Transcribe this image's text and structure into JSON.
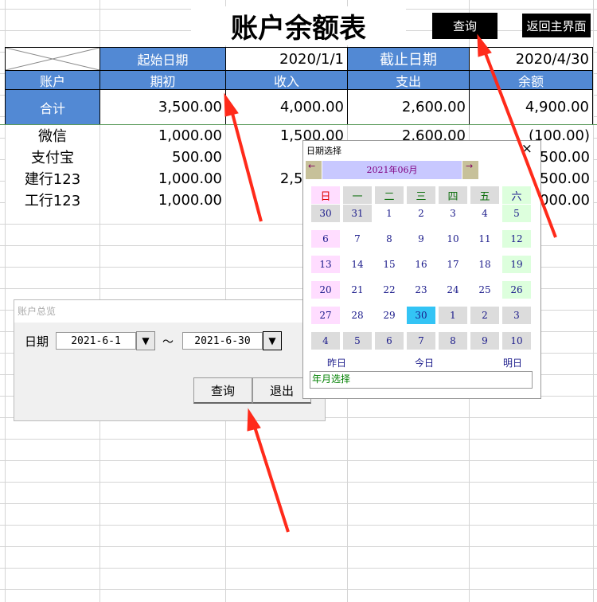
{
  "title": "账户余额表",
  "buttons": {
    "query": "查询",
    "back": "返回主界面"
  },
  "header": {
    "start_label": "起始日期",
    "start_value": "2020/1/1",
    "end_label": "截止日期",
    "end_value": "2020/4/30"
  },
  "columns": [
    "账户",
    "期初",
    "收入",
    "支出",
    "余额"
  ],
  "total": {
    "label": "合计",
    "opening": "3,500.00",
    "income": "4,000.00",
    "expense": "2,600.00",
    "balance": "4,900.00"
  },
  "rows": [
    {
      "account": "微信",
      "opening": "1,000.00",
      "income": "1,500.00",
      "expense": "2,600.00",
      "balance": "(100.00)"
    },
    {
      "account": "支付宝",
      "opening": "500.00",
      "income": "",
      "expense": "",
      "balance": "500.00"
    },
    {
      "account": "建行123",
      "opening": "1,000.00",
      "income": "2,500.00",
      "expense": "",
      "balance": "3,500.00"
    },
    {
      "account": "工行123",
      "opening": "1,000.00",
      "income": "",
      "expense": "",
      "balance": "1,000.00"
    }
  ],
  "calendar": {
    "title": "日期选择",
    "month": "2021年06月",
    "prev": "←",
    "next": "→",
    "close": "×",
    "weekdays": [
      "日",
      "一",
      "二",
      "三",
      "四",
      "五",
      "六"
    ],
    "days": [
      "30",
      "31",
      "1",
      "2",
      "3",
      "4",
      "5",
      "6",
      "7",
      "8",
      "9",
      "10",
      "11",
      "12",
      "13",
      "14",
      "15",
      "16",
      "17",
      "18",
      "19",
      "20",
      "21",
      "22",
      "23",
      "24",
      "25",
      "26",
      "27",
      "28",
      "29",
      "30",
      "1",
      "2",
      "3",
      "4",
      "5",
      "6",
      "7",
      "8",
      "9",
      "10"
    ],
    "selected": "30",
    "yesterday": "昨日",
    "today": "今日",
    "tomorrow": "明日",
    "ym_select": "年月选择"
  },
  "dialog": {
    "title": "账户总览",
    "date_label": "日期",
    "from": "2021-6-1",
    "to": "2021-6-30",
    "sep": "～",
    "dropdown": "▼",
    "query": "查询",
    "exit": "退出"
  },
  "colors": {
    "header_blue": "#5289d4",
    "selected_day": "#33c4f5",
    "sunday": "#ffddff",
    "saturday": "#ddffdd",
    "arrow": "#ff2a1a"
  }
}
